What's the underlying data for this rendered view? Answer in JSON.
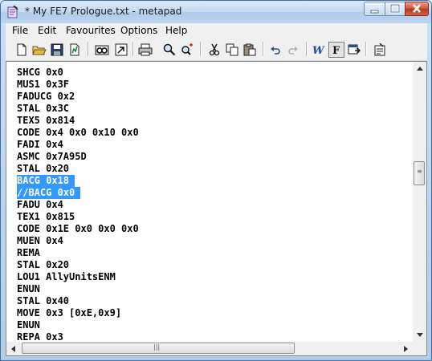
{
  "window": {
    "title": "* My FE7 Prologue.txt - metapad"
  },
  "menu": [
    "File",
    "Edit",
    "Favourites",
    "Options",
    "Help"
  ],
  "toolbar": [
    "new-file-icon",
    "open-folder-icon",
    "save-icon",
    "save-as-icon",
    "print-preview-icon",
    "launch-viewer-icon",
    "print-icon",
    "find-icon",
    "replace-icon",
    "cut-icon",
    "copy-icon",
    "paste-icon",
    "undo-icon",
    "redo-icon",
    "word-wrap-icon",
    "font-toggle-icon",
    "always-on-top-icon",
    "settings-icon"
  ],
  "editor": {
    "lines": [
      "SHCG 0x0",
      "MUS1 0x3F",
      "FADUCG 0x2",
      "STAL 0x3C",
      "TEX5 0x814",
      "CODE 0x4 0x0 0x10 0x0",
      "FADI 0x4",
      "ASMC 0x7A95D",
      "STAL 0x20",
      "BACG 0x18 ",
      "//BACG 0x0 ",
      "FADU 0x4",
      "TEX1 0x815",
      "CODE 0x1E 0x0 0x0 0x0",
      "MUEN 0x4",
      "REMA",
      "STAL 0x20",
      "LOU1 AllyUnitsENM",
      "ENUN",
      "STAL 0x40",
      "MOVE 0x3 [0xE,0x9]",
      "ENUN",
      "REPA 0x3"
    ],
    "selected_lines": [
      9,
      10
    ]
  },
  "colors": {
    "selection": "#3399ff",
    "titlebar": "#c3d9f0",
    "close_button": "#c75037"
  }
}
